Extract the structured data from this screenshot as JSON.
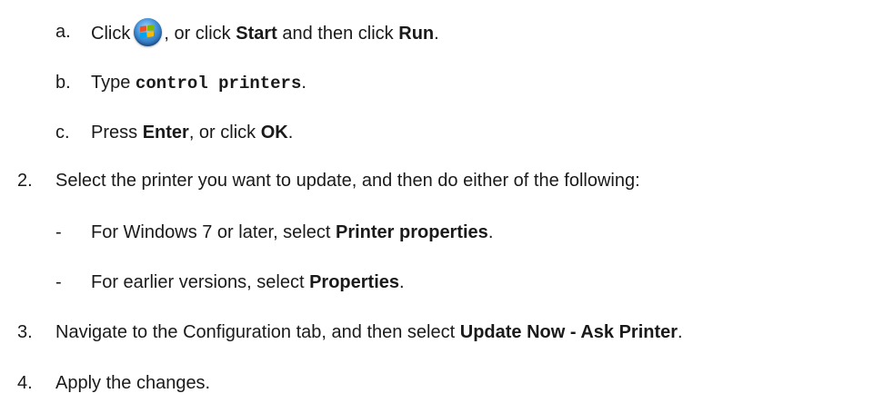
{
  "steps": {
    "a": {
      "marker": "a.",
      "text_before": "Click",
      "icon": "windows-start-orb-icon",
      "text_after": ", or click ",
      "start": "Start",
      "and_then": " and then click ",
      "run": "Run",
      "end": "."
    },
    "b": {
      "marker": "b.",
      "text_before": "Type ",
      "command": "control printers",
      "end": "."
    },
    "c": {
      "marker": "c.",
      "text_before": "Press ",
      "enter": "Enter",
      "middle": ", or click ",
      "ok": "OK",
      "end": "."
    },
    "step2": {
      "marker": "2.",
      "text": "Select the printer you want to update, and then do either of the following:"
    },
    "bullet1": {
      "marker": "-",
      "text_before": "For Windows 7 or later, select ",
      "bold": "Printer properties",
      "end": "."
    },
    "bullet2": {
      "marker": "-",
      "text_before": "For earlier versions, select ",
      "bold": "Properties",
      "end": "."
    },
    "step3": {
      "marker": "3.",
      "text_before": "Navigate to the Configuration tab, and then select ",
      "bold": "Update Now - Ask Printer",
      "end": "."
    },
    "step4": {
      "marker": "4.",
      "text": "Apply the changes."
    }
  }
}
